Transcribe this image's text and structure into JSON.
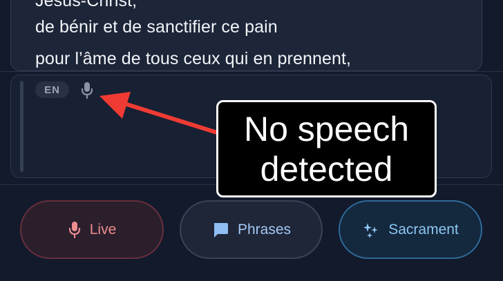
{
  "transcript": {
    "lines": [
      "Jésus-Christ,",
      "de bénir et de sanctifier ce pain",
      "pour l’âme de tous ceux qui en prennent,"
    ]
  },
  "input": {
    "language": "EN",
    "mic_icon": "microphone-icon"
  },
  "actions": {
    "live": {
      "label": "Live",
      "icon": "microphone-icon",
      "color": "#ec8c8f"
    },
    "phrases": {
      "label": "Phrases",
      "icon": "chat-bubble-icon",
      "color": "#a5c8f5"
    },
    "sacrament": {
      "label": "Sacrament",
      "icon": "sparkle-icon",
      "color": "#8cc7f2"
    }
  },
  "annotation": {
    "text": "No speech detected",
    "arrow_color": "#ef3b34"
  }
}
